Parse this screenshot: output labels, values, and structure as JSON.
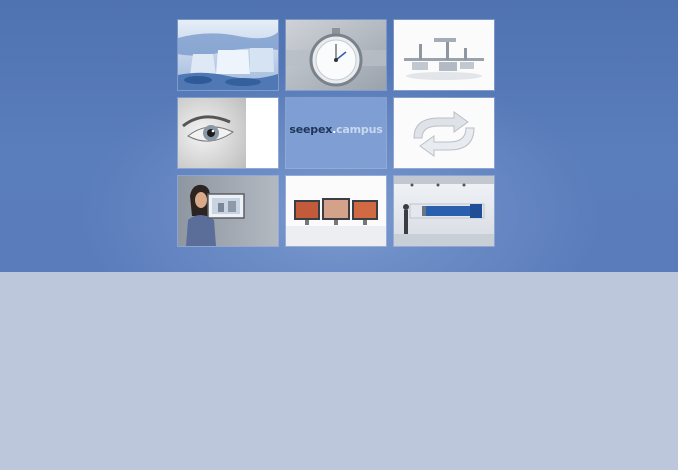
{
  "page": {
    "colors": {
      "hero_top": "#4f72b0",
      "hero_glow": "#7f9bcf",
      "lower_background": "#bcc7db",
      "campus_tile": "#7f9fd4"
    }
  },
  "tiles": [
    {
      "name": "waterfall",
      "icon": "waterfall-image"
    },
    {
      "name": "stopwatch",
      "icon": "stopwatch-image"
    },
    {
      "name": "pipeline",
      "icon": "pipeline-model-image"
    },
    {
      "name": "eye",
      "icon": "eye-image"
    },
    {
      "name": "campus",
      "icon": "seepex-campus-logo"
    },
    {
      "name": "arrows",
      "icon": "curved-arrows-image"
    },
    {
      "name": "woman-laptop",
      "icon": "woman-with-laptop-image"
    },
    {
      "name": "monitors",
      "icon": "monitors-image"
    },
    {
      "name": "showroom",
      "icon": "showroom-pump-image"
    }
  ],
  "campus": {
    "brand": "seepex",
    "separator": ".",
    "word": "campus"
  }
}
